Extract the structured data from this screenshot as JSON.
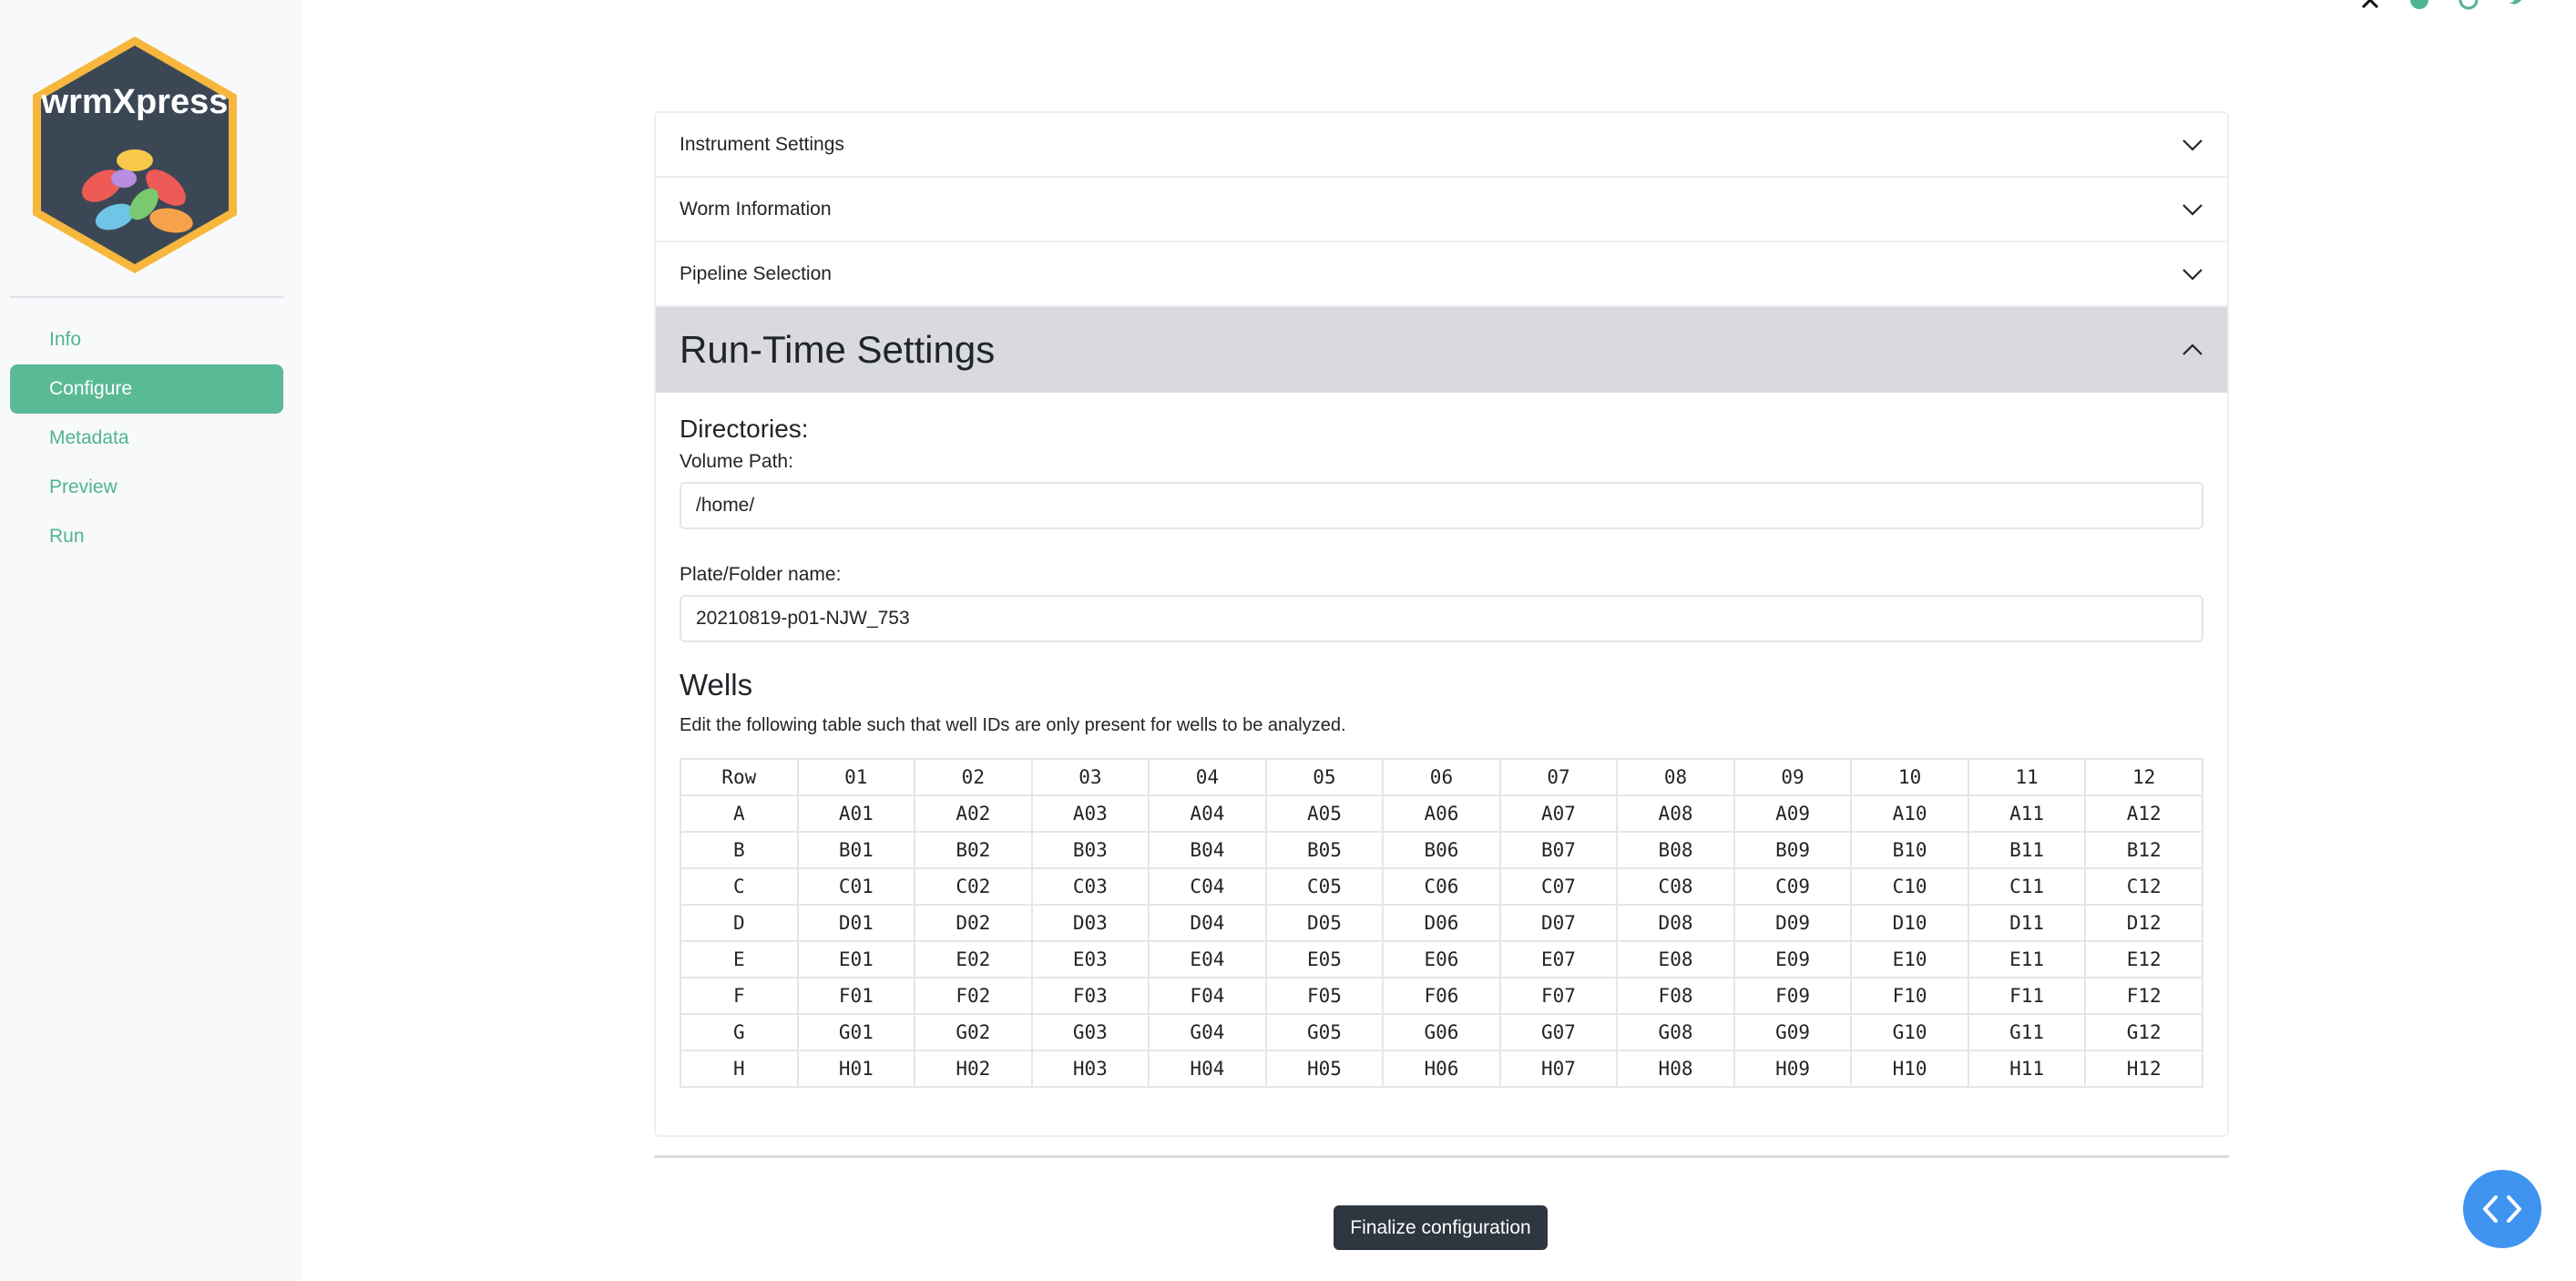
{
  "brand": {
    "name": "wrmXpress"
  },
  "nav": [
    {
      "label": "Info",
      "active": false
    },
    {
      "label": "Configure",
      "active": true
    },
    {
      "label": "Metadata",
      "active": false
    },
    {
      "label": "Preview",
      "active": false
    },
    {
      "label": "Run",
      "active": false
    }
  ],
  "accordion": {
    "instrument": "Instrument Settings",
    "worm": "Worm Information",
    "pipeline": "Pipeline Selection",
    "runtime": "Run-Time Settings"
  },
  "runtime": {
    "directories_label": "Directories:",
    "volume_label": "Volume Path:",
    "volume_value": "/home/",
    "plate_label": "Plate/Folder name:",
    "plate_value": "20210819-p01-NJW_753",
    "wells_title": "Wells",
    "wells_note": "Edit the following table such that well IDs are only present for wells to be analyzed."
  },
  "wells_table": {
    "headers": [
      "Row",
      "01",
      "02",
      "03",
      "04",
      "05",
      "06",
      "07",
      "08",
      "09",
      "10",
      "11",
      "12"
    ],
    "rows": [
      [
        "A",
        "A01",
        "A02",
        "A03",
        "A04",
        "A05",
        "A06",
        "A07",
        "A08",
        "A09",
        "A10",
        "A11",
        "A12"
      ],
      [
        "B",
        "B01",
        "B02",
        "B03",
        "B04",
        "B05",
        "B06",
        "B07",
        "B08",
        "B09",
        "B10",
        "B11",
        "B12"
      ],
      [
        "C",
        "C01",
        "C02",
        "C03",
        "C04",
        "C05",
        "C06",
        "C07",
        "C08",
        "C09",
        "C10",
        "C11",
        "C12"
      ],
      [
        "D",
        "D01",
        "D02",
        "D03",
        "D04",
        "D05",
        "D06",
        "D07",
        "D08",
        "D09",
        "D10",
        "D11",
        "D12"
      ],
      [
        "E",
        "E01",
        "E02",
        "E03",
        "E04",
        "E05",
        "E06",
        "E07",
        "E08",
        "E09",
        "E10",
        "E11",
        "E12"
      ],
      [
        "F",
        "F01",
        "F02",
        "F03",
        "F04",
        "F05",
        "F06",
        "F07",
        "F08",
        "F09",
        "F10",
        "F11",
        "F12"
      ],
      [
        "G",
        "G01",
        "G02",
        "G03",
        "G04",
        "G05",
        "G06",
        "G07",
        "G08",
        "G09",
        "G10",
        "G11",
        "G12"
      ],
      [
        "H",
        "H01",
        "H02",
        "H03",
        "H04",
        "H05",
        "H06",
        "H07",
        "H08",
        "H09",
        "H10",
        "H11",
        "H12"
      ]
    ]
  },
  "actions": {
    "finalize": "Finalize configuration"
  },
  "icons": {
    "top": [
      "x-twitter-icon",
      "circle-icon",
      "github-icon",
      "twitter-icon"
    ],
    "fab": "code-icon"
  },
  "colors": {
    "accent": "#5bba96",
    "nav_text": "#4fb590",
    "dark_button": "#2e3640",
    "fab": "#3f94f0",
    "header_open": "#d9dadf"
  }
}
